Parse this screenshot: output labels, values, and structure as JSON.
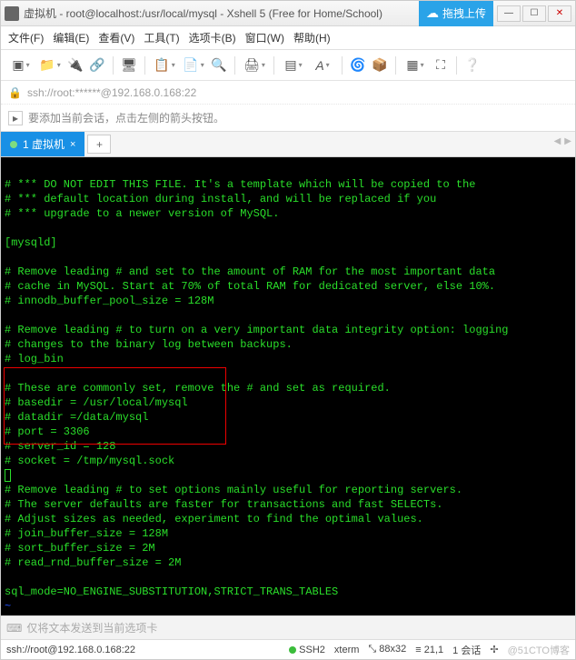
{
  "window": {
    "title": "虚拟机 - root@localhost:/usr/local/mysql - Xshell 5 (Free for Home/School)",
    "upload_label": "拖拽上传"
  },
  "menu": {
    "file": "文件(F)",
    "edit": "编辑(E)",
    "view": "查看(V)",
    "tools": "工具(T)",
    "tabs": "选项卡(B)",
    "window": "窗口(W)",
    "help": "帮助(H)"
  },
  "address": {
    "url": "ssh://root:******@192.168.0.168:22"
  },
  "hint": {
    "text": "要添加当前会话，点击左侧的箭头按钮。"
  },
  "tabs": {
    "active": "1 虚拟机"
  },
  "terminal": {
    "l1": "# *** DO NOT EDIT THIS FILE. It's a template which will be copied to the",
    "l2": "# *** default location during install, and will be replaced if you",
    "l3": "# *** upgrade to a newer version of MySQL.",
    "l4": "[mysqld]",
    "l5": "# Remove leading # and set to the amount of RAM for the most important data",
    "l6": "# cache in MySQL. Start at 70% of total RAM for dedicated server, else 10%.",
    "l7": "# innodb_buffer_pool_size = 128M",
    "l8": "# Remove leading # to turn on a very important data integrity option: logging",
    "l9": "# changes to the binary log between backups.",
    "l10": "# log_bin",
    "l11": "# These are commonly set, remove the # and set as required.",
    "l12": "# basedir = /usr/local/mysql",
    "l13": "# datadir =/data/mysql",
    "l14": "# port = 3306",
    "l15": "# server_id = 128",
    "l16": "# socket = /tmp/mysql.sock",
    "l17": "# Remove leading # to set options mainly useful for reporting servers.",
    "l18": "# The server defaults are faster for transactions and fast SELECTs.",
    "l19": "# Adjust sizes as needed, experiment to find the optimal values.",
    "l20": "# join_buffer_size = 128M",
    "l21": "# sort_buffer_size = 2M",
    "l22": "# read_rnd_buffer_size = 2M",
    "l23": "sql_mode=NO_ENGINE_SUBSTITUTION,STRICT_TRANS_TABLES",
    "tilde": "~"
  },
  "sendbar": {
    "placeholder": "仅将文本发送到当前选项卡"
  },
  "status": {
    "conn": "ssh://root@192.168.0.168:22",
    "proto": "SSH2",
    "term": "xterm",
    "size": "88x32",
    "pos": "21,1",
    "sessions": "1 会话",
    "watermark": "@51CTO博客",
    "rows_icon": "�izumi",
    "arrows": "↕ ↔"
  }
}
